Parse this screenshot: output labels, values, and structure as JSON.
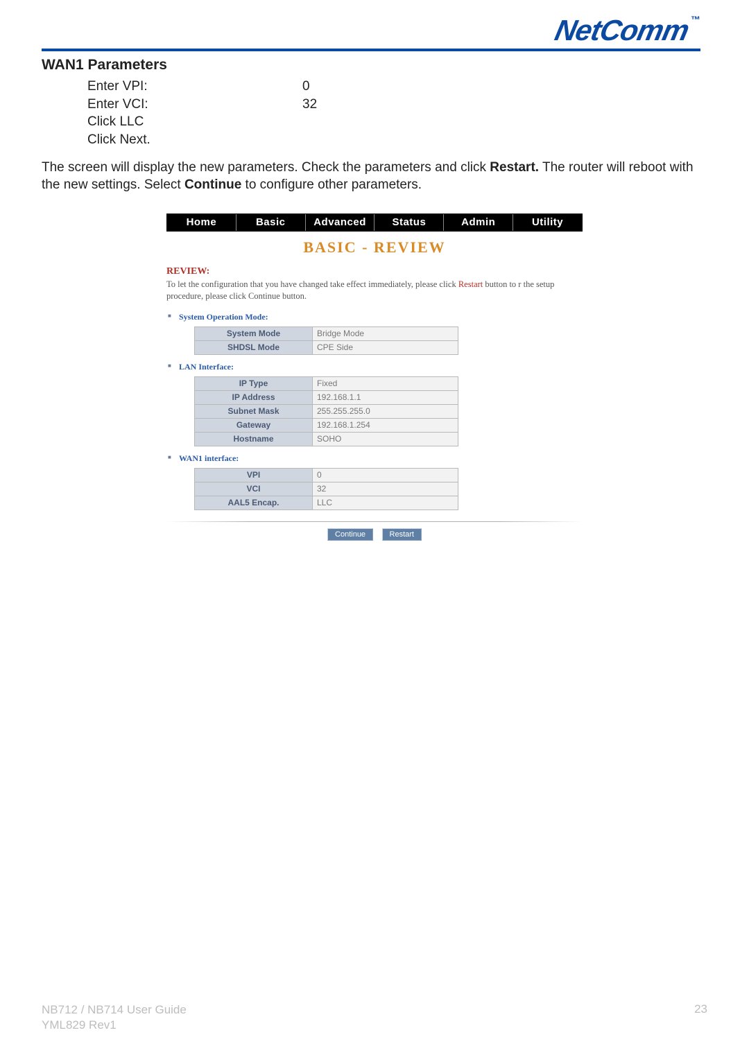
{
  "brand": {
    "name": "NetComm",
    "tm": "™"
  },
  "section_heading": "WAN1 Parameters",
  "param_steps": [
    {
      "label": "Enter VPI:",
      "value": "0"
    },
    {
      "label": "Enter VCI:",
      "value": "32"
    },
    {
      "label": "Click LLC",
      "value": ""
    },
    {
      "label": "Click Next.",
      "value": ""
    }
  ],
  "body_text_1": "The screen will display the new parameters. Check the parameters and click ",
  "body_text_restart": "Restart.",
  "body_text_2": " The router will reboot with the new settings.  Select ",
  "body_text_continue": "Continue",
  "body_text_3": " to configure other parameters.",
  "tabs": [
    "Home",
    "Basic",
    "Advanced",
    "Status",
    "Admin",
    "Utility"
  ],
  "panel_title": "BASIC - REVIEW",
  "review": {
    "heading": "REVIEW:",
    "text_a": "To let the configuration that you have changed take effect immediately,  please click ",
    "text_restart": "Restart",
    "text_b": " button to r the setup procedure, please click Continue button."
  },
  "sys_op": {
    "heading": "System Operation Mode:",
    "rows": [
      {
        "k": "System Mode",
        "v": "Bridge Mode"
      },
      {
        "k": "SHDSL Mode",
        "v": "CPE Side"
      }
    ]
  },
  "lan_if": {
    "heading": "LAN Interface:",
    "rows": [
      {
        "k": "IP Type",
        "v": "Fixed"
      },
      {
        "k": "IP Address",
        "v": "192.168.1.1"
      },
      {
        "k": "Subnet Mask",
        "v": "255.255.255.0"
      },
      {
        "k": "Gateway",
        "v": "192.168.1.254"
      },
      {
        "k": "Hostname",
        "v": "SOHO"
      }
    ]
  },
  "wan1_if": {
    "heading": "WAN1 interface:",
    "rows": [
      {
        "k": "VPI",
        "v": "0"
      },
      {
        "k": "VCI",
        "v": "32"
      },
      {
        "k": "AAL5 Encap.",
        "v": "LLC"
      }
    ]
  },
  "buttons": {
    "continue": "Continue",
    "restart": "Restart"
  },
  "footer": {
    "guide": "NB712 / NB714 User Guide",
    "rev": "YML829 Rev1",
    "page": "23"
  }
}
